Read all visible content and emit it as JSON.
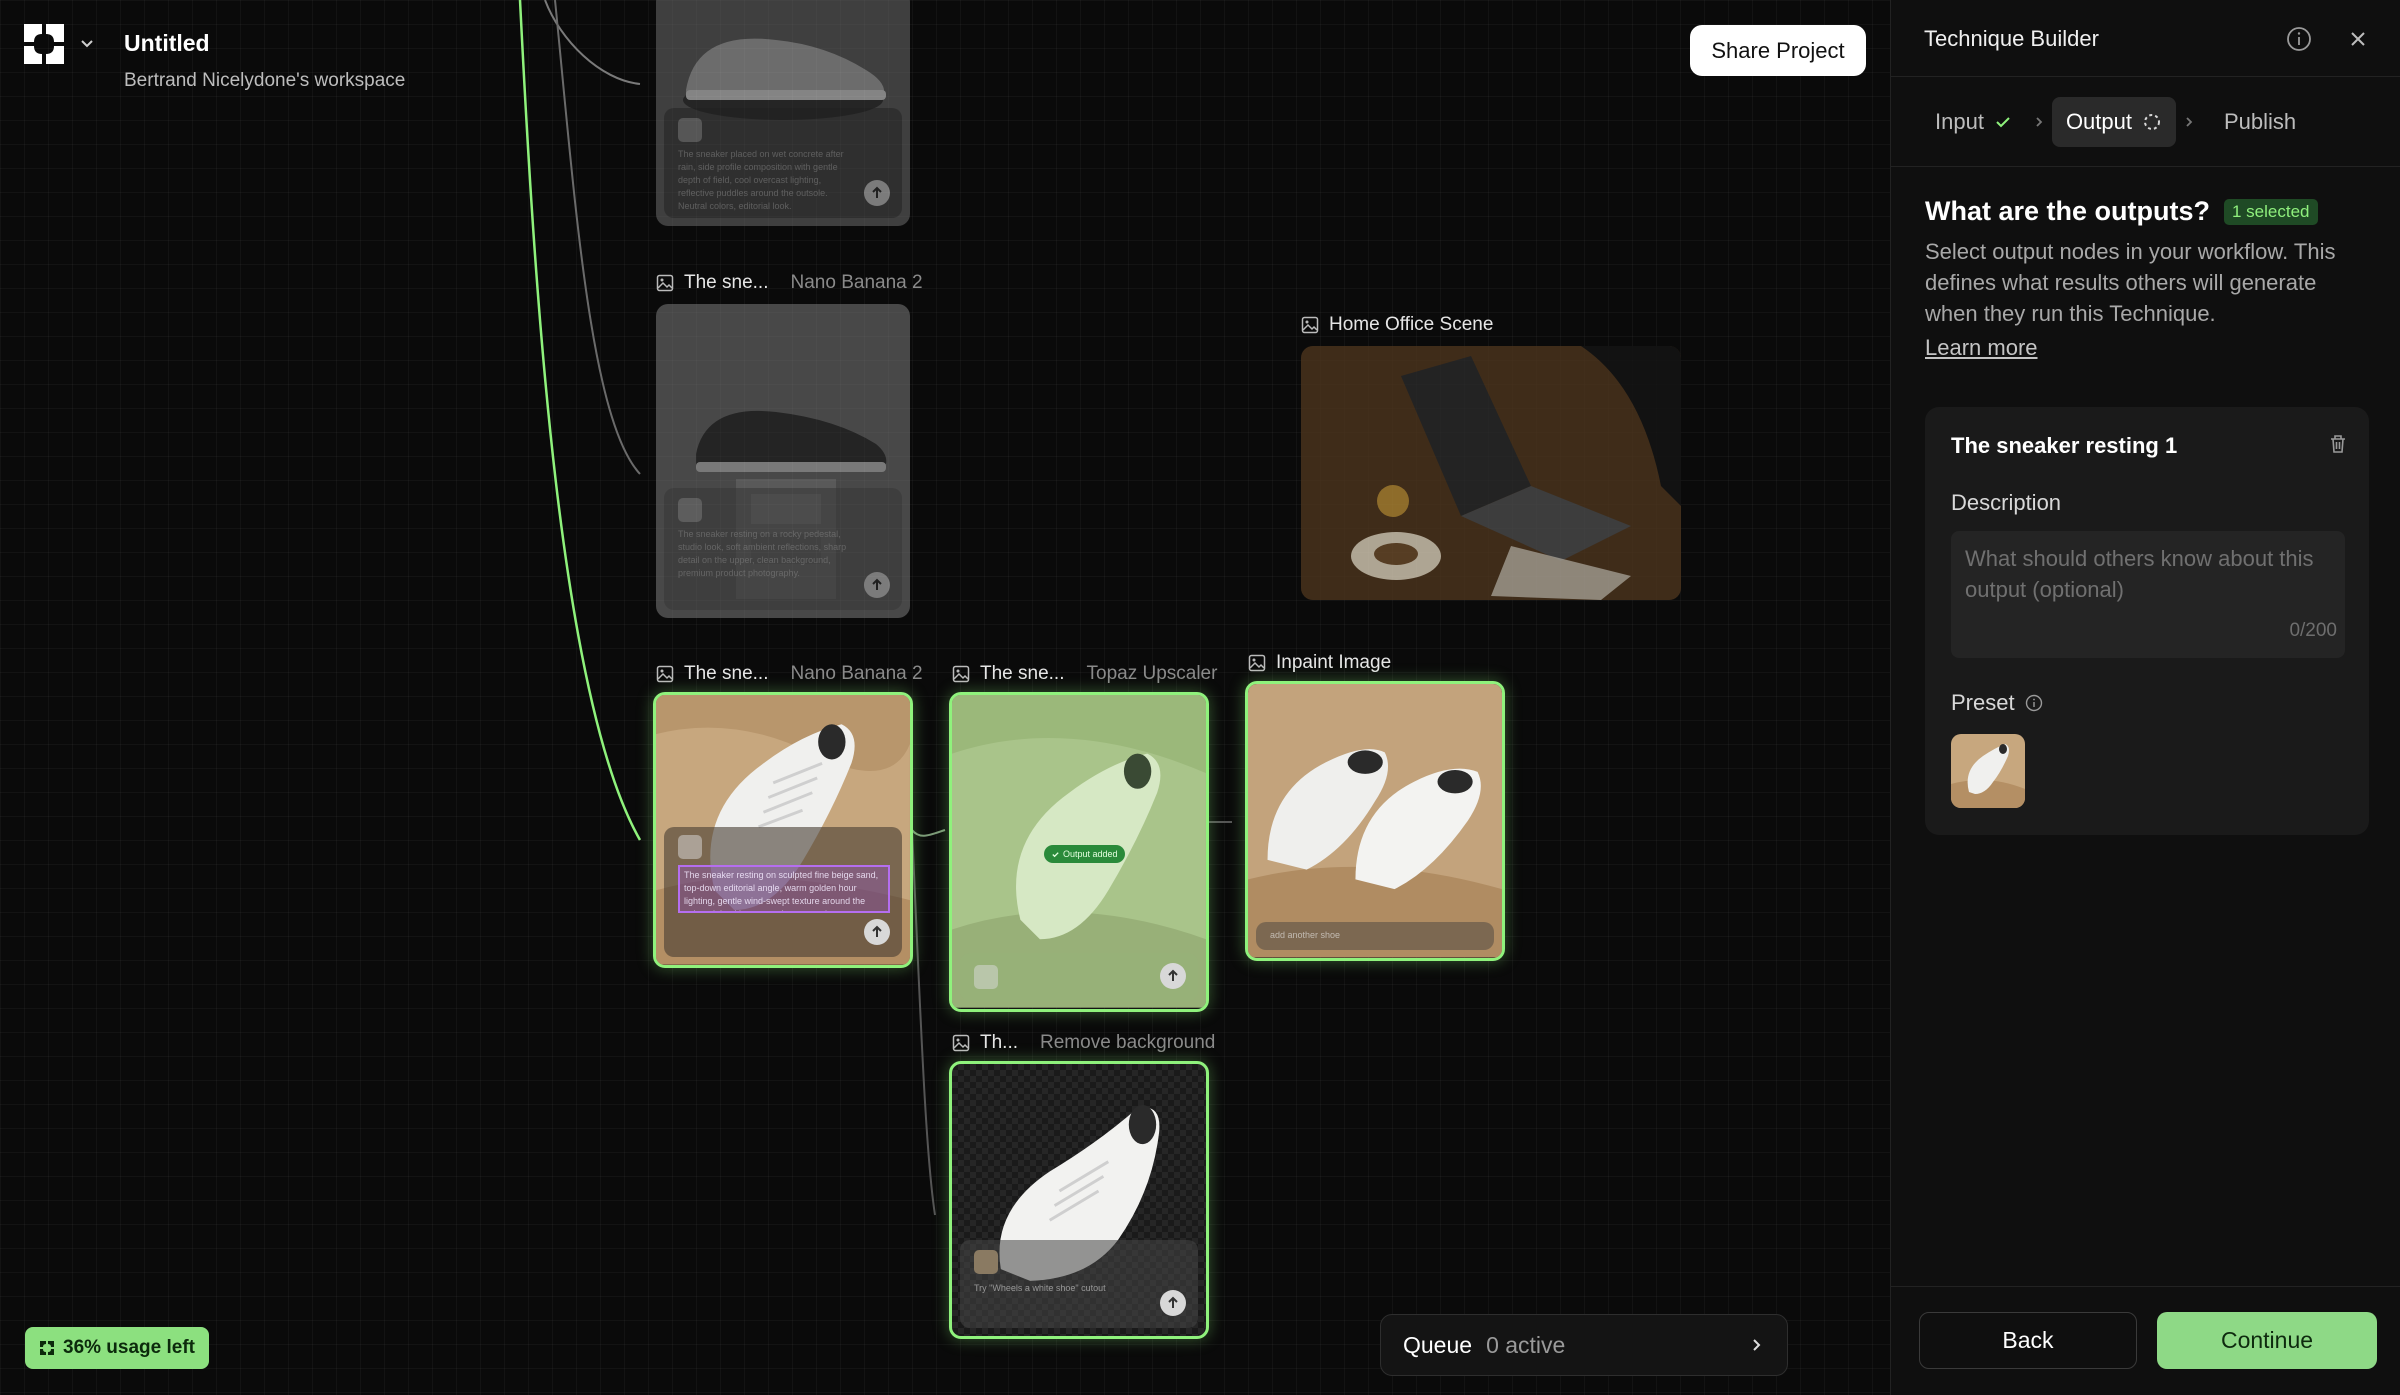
{
  "app": {
    "project_title": "Untitled",
    "workspace": "Bertrand Nicelydone's workspace",
    "share_label": "Share Project"
  },
  "canvas": {
    "nodes": [
      {
        "title": "",
        "model": ""
      },
      {
        "title": "The sne...",
        "model": "Nano Banana 2"
      },
      {
        "title": "Home Office Scene",
        "model": ""
      },
      {
        "title": "The sne...",
        "model": "Nano Banana 2"
      },
      {
        "title": "The sne...",
        "model": "Topaz Upscaler"
      },
      {
        "title": "Inpaint Image",
        "model": ""
      },
      {
        "title": "Th...",
        "model": "Remove background"
      }
    ],
    "prompt_texts": {
      "top": "The sneaker placed on wet concrete after rain, side profile composition with gentle depth of field, cool overcast lighting, reflective puddles around the outsole. Neutral colors, editorial look.",
      "second": "The sneaker resting on a rocky pedestal, studio look, soft ambient reflections, sharp detail on the upper, clean background, premium product photography.",
      "selected": "The sneaker resting on sculpted fine beige sand, top-down editorial angle, warm golden hour lighting, gentle wind-swept texture around the sole, minimal luxury product campaign atmosphere, soft",
      "inpaint": "add another shoe",
      "remove_bg": "Try \"Wheels a white shoe\" cutout"
    },
    "output_badge": "Output added"
  },
  "usage": {
    "label": "36% usage left"
  },
  "queue": {
    "title": "Queue",
    "status": "0 active"
  },
  "panel": {
    "title": "Technique Builder",
    "steps": [
      {
        "label": "Input",
        "state": "done"
      },
      {
        "label": "Output",
        "state": "active"
      },
      {
        "label": "Publish",
        "state": "pending"
      }
    ],
    "heading": "What are the outputs?",
    "selected_badge": "1 selected",
    "description": "Select output nodes in your workflow. This defines what results others will generate when they run this Technique.",
    "learn_more": "Learn more",
    "output_card": {
      "name": "The sneaker resting 1",
      "description_label": "Description",
      "description_placeholder": "What should others know about this output (optional)",
      "char_count": "0/200",
      "preset_label": "Preset"
    },
    "back_label": "Back",
    "continue_label": "Continue"
  },
  "colors": {
    "accent_green": "#8ff27c",
    "continue_bg": "#8ed986",
    "selected_badge_bg": "#1f4a25"
  }
}
